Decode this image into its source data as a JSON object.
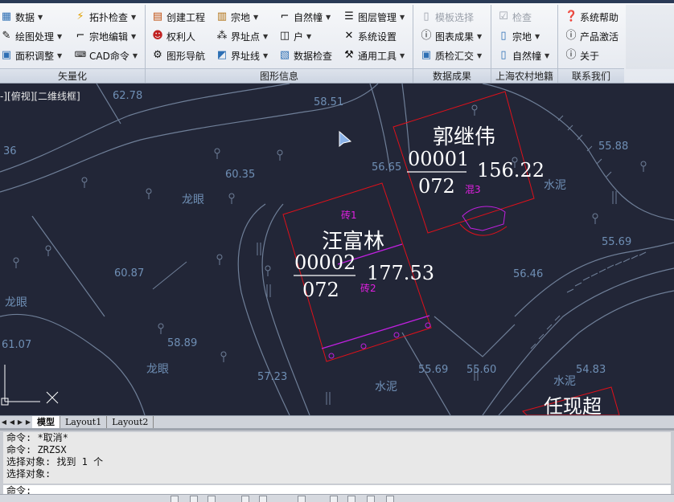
{
  "ribbon": {
    "panels": [
      {
        "label": "矢量化"
      },
      {
        "label": "图形信息"
      },
      {
        "label": "数据成果"
      },
      {
        "label": "上海农村地籍"
      },
      {
        "label": "联系我们"
      }
    ],
    "vectorize": {
      "data": "数据",
      "draw": "绘图处理",
      "area": "面积调整",
      "topo": "拓扑检查",
      "parcel_edit": "宗地编辑",
      "cad_cmd": "CAD命令"
    },
    "graphic": {
      "create_project": "创建工程",
      "right_holder": "权利人",
      "nav": "图形导航",
      "parcel": "宗地",
      "boundary_point": "界址点",
      "boundary_line": "界址线",
      "natural_building": "自然幢",
      "household": "户",
      "data_check": "数据检查",
      "layer_mgr": "图层管理",
      "sys_settings": "系统设置",
      "tools": "通用工具"
    },
    "results": {
      "template": "模板选择",
      "chart": "图表成果",
      "qc": "质检汇交"
    },
    "shanghai": {
      "check": "检查",
      "parcel": "宗地",
      "building": "自然幢"
    },
    "contact": {
      "help": "系统帮助",
      "activate": "产品激活",
      "about": "关于"
    }
  },
  "canvas": {
    "view_label": "-][俯视][二维线框]",
    "parcels": [
      {
        "owner": "郭继伟",
        "code": "00001",
        "sub": "072",
        "area": "156.22",
        "material": "混3"
      },
      {
        "owner": "汪富林",
        "code": "00002",
        "sub": "072",
        "area": "177.53",
        "material_top": "砖1",
        "material_bottom": "砖2"
      },
      {
        "owner": "任现超"
      }
    ],
    "elevations": [
      "62.78",
      "58.51",
      "36",
      "60.35",
      "56.65",
      "55.88",
      "60.87",
      "55.69",
      "56.46",
      "61.07",
      "58.89",
      "57.23",
      "55.69",
      "55.60",
      "54.83"
    ],
    "place_labels": [
      "龙眼",
      "龙眼",
      "龙眼",
      "水泥",
      "水泥",
      "水泥"
    ]
  },
  "tabs": {
    "model": "模型",
    "layout1": "Layout1",
    "layout2": "Layout2"
  },
  "command": {
    "history": [
      "命令: *取消*",
      "命令: ZRZSX",
      "选择对象: 找到 1 个",
      "选择对象:"
    ],
    "prompt": "命令:"
  },
  "colors": {
    "canvas_bg": "#222637",
    "terrain": "#6f7f98",
    "parcel_outline": "#e0101a",
    "annotation": "#ffffff",
    "material_label": "#e020e0"
  }
}
